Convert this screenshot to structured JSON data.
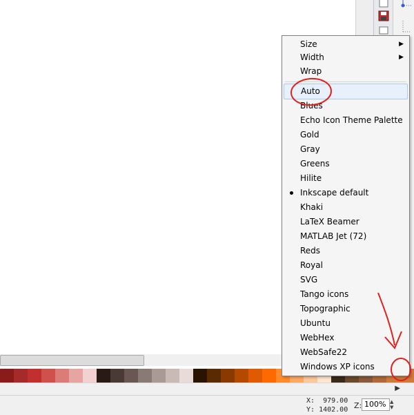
{
  "menu": {
    "items": [
      {
        "label": "Size",
        "submenu": true
      },
      {
        "label": "Width",
        "submenu": true
      },
      {
        "label": "Wrap"
      },
      {
        "label": "Auto",
        "highlighted": true
      },
      {
        "label": "Blues"
      },
      {
        "label": "Echo Icon Theme Palette"
      },
      {
        "label": "Gold"
      },
      {
        "label": "Gray"
      },
      {
        "label": "Greens"
      },
      {
        "label": "Hilite"
      },
      {
        "label": "Inkscape default",
        "selected": true
      },
      {
        "label": "Khaki"
      },
      {
        "label": "LaTeX Beamer"
      },
      {
        "label": "MATLAB Jet (72)"
      },
      {
        "label": "Reds"
      },
      {
        "label": "Royal"
      },
      {
        "label": "SVG"
      },
      {
        "label": "Tango icons"
      },
      {
        "label": "Topographic"
      },
      {
        "label": "Ubuntu"
      },
      {
        "label": "WebHex"
      },
      {
        "label": "WebSafe22"
      },
      {
        "label": "Windows XP icons"
      }
    ]
  },
  "status": {
    "x_label": "X:",
    "x_value": "979.00",
    "y_label": "Y:",
    "y_value": "1402.00",
    "zoom_label": "Z:",
    "zoom_value": "100%"
  },
  "palette": {
    "swatches": [
      "#8b1a1a",
      "#a52a2a",
      "#c0302e",
      "#d0504c",
      "#dc7c78",
      "#e6a5a2",
      "#f2d2d0",
      "#2a1a16",
      "#4a3a36",
      "#6a5652",
      "#8a7a76",
      "#aa9a96",
      "#cabab6",
      "#e8dcd8",
      "#2a1400",
      "#5a2a00",
      "#8a3a00",
      "#b44a00",
      "#e05a00",
      "#ff6a00",
      "#ff8a2a",
      "#ffa860",
      "#ffc898",
      "#ffe6d0",
      "#3a2a1a",
      "#6a4a2a",
      "#8a5a3a",
      "#b06a3a",
      "#d07a3a"
    ],
    "scroll_arrow_icon": "triangle-right-icon"
  },
  "toolbar": {
    "icons": [
      "document-icon",
      "save-icon",
      "print-icon"
    ],
    "accent": "#c0302e"
  },
  "annotation_color": "#e0201a"
}
